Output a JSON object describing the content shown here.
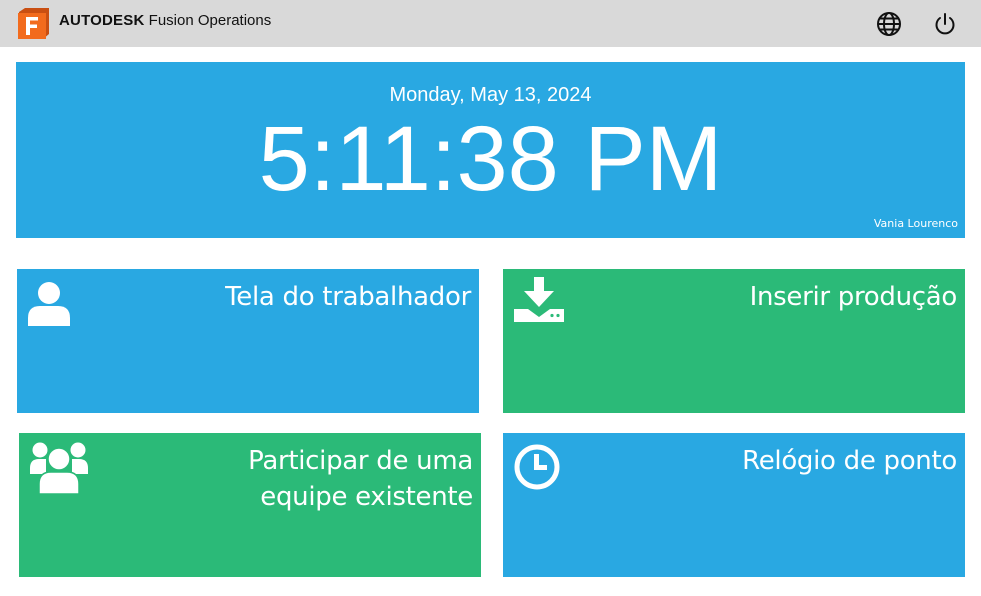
{
  "header": {
    "brand_bold": "AUTODESK",
    "brand_product": "Fusion Operations",
    "logo_letter": "F",
    "icons": {
      "language": "globe-icon",
      "logout": "power-icon"
    }
  },
  "clock": {
    "date": "Monday, May 13, 2024",
    "time": "5:11:38 PM",
    "user": "Vania Lourenco"
  },
  "tiles": [
    {
      "label": "Tela do trabalhador",
      "icon": "user-icon",
      "color": "#29a8e2"
    },
    {
      "label": "Inserir produção",
      "icon": "download-icon",
      "color": "#2bba78"
    },
    {
      "label": "Participar de uma\nequipe existente",
      "icon": "team-icon",
      "color": "#2bba78"
    },
    {
      "label": "Relógio de ponto",
      "icon": "clock-icon",
      "color": "#29a8e2"
    }
  ],
  "colors": {
    "topbar": "#d9d9d9",
    "blue": "#29a8e2",
    "green": "#2bba78",
    "logo_orange": "#f26b1d"
  }
}
